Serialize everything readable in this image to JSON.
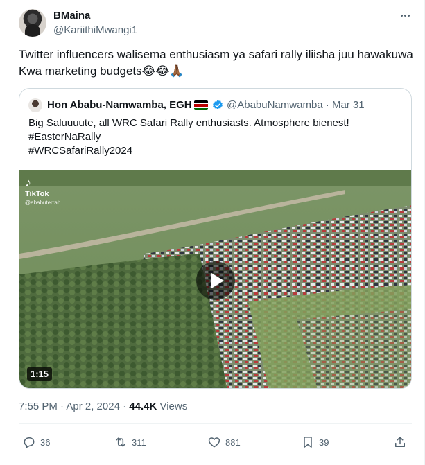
{
  "author": {
    "name": "BMaina",
    "handle": "@KariithiMwangi1"
  },
  "tweet": {
    "text": "Twitter influencers walisema enthusiasm ya safari rally iliisha juu hawakuwa Kwa marketing budgets😂😂🙏🏾"
  },
  "quote": {
    "name": "Hon Ababu-Namwamba, EGH",
    "handle_date": "@AbabuNamwamba · Mar 31",
    "line1": "Big Saluuuute, all WRC Safari Rally enthusiasts. Atmosphere bienest!",
    "tag1": "#EasterNaRally",
    "tag2": "#WRCSafariRally2024",
    "video": {
      "watermark_logo": "♪",
      "watermark_app": "TikTok",
      "watermark_user": "@ababuterrah",
      "duration": "1:15"
    }
  },
  "meta": {
    "time_date": "7:55 PM · Apr 2, 2024 · ",
    "views_count": "44.4K",
    "views_label": " Views"
  },
  "actions": {
    "replies": "36",
    "reposts": "311",
    "likes": "881",
    "bookmarks": "39"
  },
  "colors": {
    "text": "#0f1419",
    "secondary": "#536471",
    "border": "#cfd9de",
    "verified": "#1d9bf0"
  },
  "icons": {
    "more": "more-icon",
    "verified": "verified-badge-icon",
    "flag": "kenya-flag-icon",
    "play": "play-icon",
    "reply": "reply-icon",
    "repost": "repost-icon",
    "like": "like-icon",
    "bookmark": "bookmark-icon",
    "share": "share-icon"
  }
}
